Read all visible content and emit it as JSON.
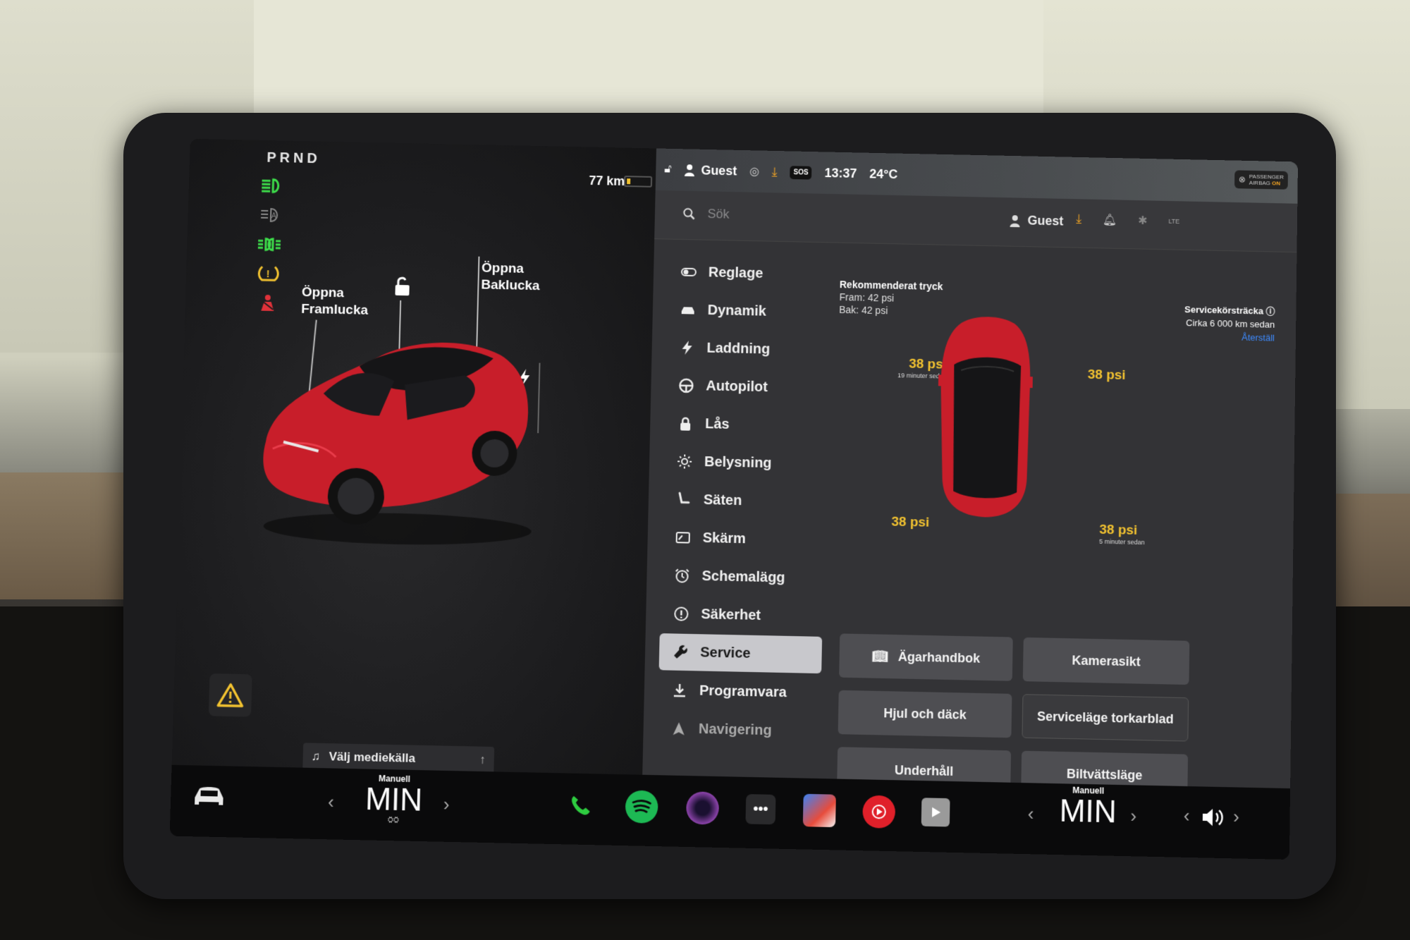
{
  "car_pane": {
    "gear": "PRND",
    "range": "77 km",
    "battery_level": 0.12,
    "front_trunk_label": [
      "Öppna",
      "Framlucka"
    ],
    "rear_trunk_label": [
      "Öppna",
      "Baklucka"
    ],
    "car_color": "#c81e2a"
  },
  "media": {
    "source_label": "Välj mediekälla"
  },
  "topbar": {
    "user": "Guest",
    "time": "13:37",
    "temperature": "24°C",
    "sos": "SOS",
    "airbag_line1": "PASSENGER",
    "airbag_line2_prefix": "AIRBAG",
    "airbag_line2_state": "ON"
  },
  "search": {
    "placeholder": "Sök"
  },
  "status": {
    "user": "Guest",
    "signal": "LTE"
  },
  "menu": {
    "items": [
      {
        "label": "Reglage",
        "icon": "toggle-icon"
      },
      {
        "label": "Dynamik",
        "icon": "car-icon"
      },
      {
        "label": "Laddning",
        "icon": "bolt-icon"
      },
      {
        "label": "Autopilot",
        "icon": "steering-wheel-icon"
      },
      {
        "label": "Lås",
        "icon": "lock-icon"
      },
      {
        "label": "Belysning",
        "icon": "sun-icon"
      },
      {
        "label": "Säten",
        "icon": "seat-icon"
      },
      {
        "label": "Skärm",
        "icon": "display-icon"
      },
      {
        "label": "Schemalägg",
        "icon": "alarm-clock-icon"
      },
      {
        "label": "Säkerhet",
        "icon": "info-circle-icon"
      },
      {
        "label": "Service",
        "icon": "wrench-icon"
      },
      {
        "label": "Programvara",
        "icon": "download-icon"
      },
      {
        "label": "Navigering",
        "icon": "navigation-arrow-icon"
      }
    ],
    "active_index": 10
  },
  "service": {
    "recommended_title": "Rekommenderat tryck",
    "recommended_front": "Fram: 42 psi",
    "recommended_rear": "Bak: 42 psi",
    "odometer_title": "Servicekörsträcka",
    "odometer_value": "Cirka 6 000 km sedan",
    "odometer_reset": "Återställ",
    "tires": {
      "front_left": {
        "value": "38 psi",
        "note": "19 minuter sedan"
      },
      "front_right": {
        "value": "38 psi",
        "note": ""
      },
      "rear_left": {
        "value": "38 psi",
        "note": ""
      },
      "rear_right": {
        "value": "38 psi",
        "note": "5 minuter sedan"
      }
    },
    "buttons": {
      "manual": "Ägarhandbok",
      "camera": "Kamerasikt",
      "wheels": "Hjul och däck",
      "wiper": "Serviceläge torkarblad",
      "maintenance": "Underhåll",
      "carwash": "Biltvättsläge"
    }
  },
  "dock": {
    "driver_climate": {
      "mode": "Manuell",
      "temp": "MIN"
    },
    "passenger_climate": {
      "mode": "Manuell",
      "temp": "MIN"
    },
    "apps": [
      "phone-icon",
      "spotify-icon",
      "camera-lens-icon",
      "more-icon",
      "maps-icon",
      "music-icon",
      "theater-icon"
    ]
  }
}
